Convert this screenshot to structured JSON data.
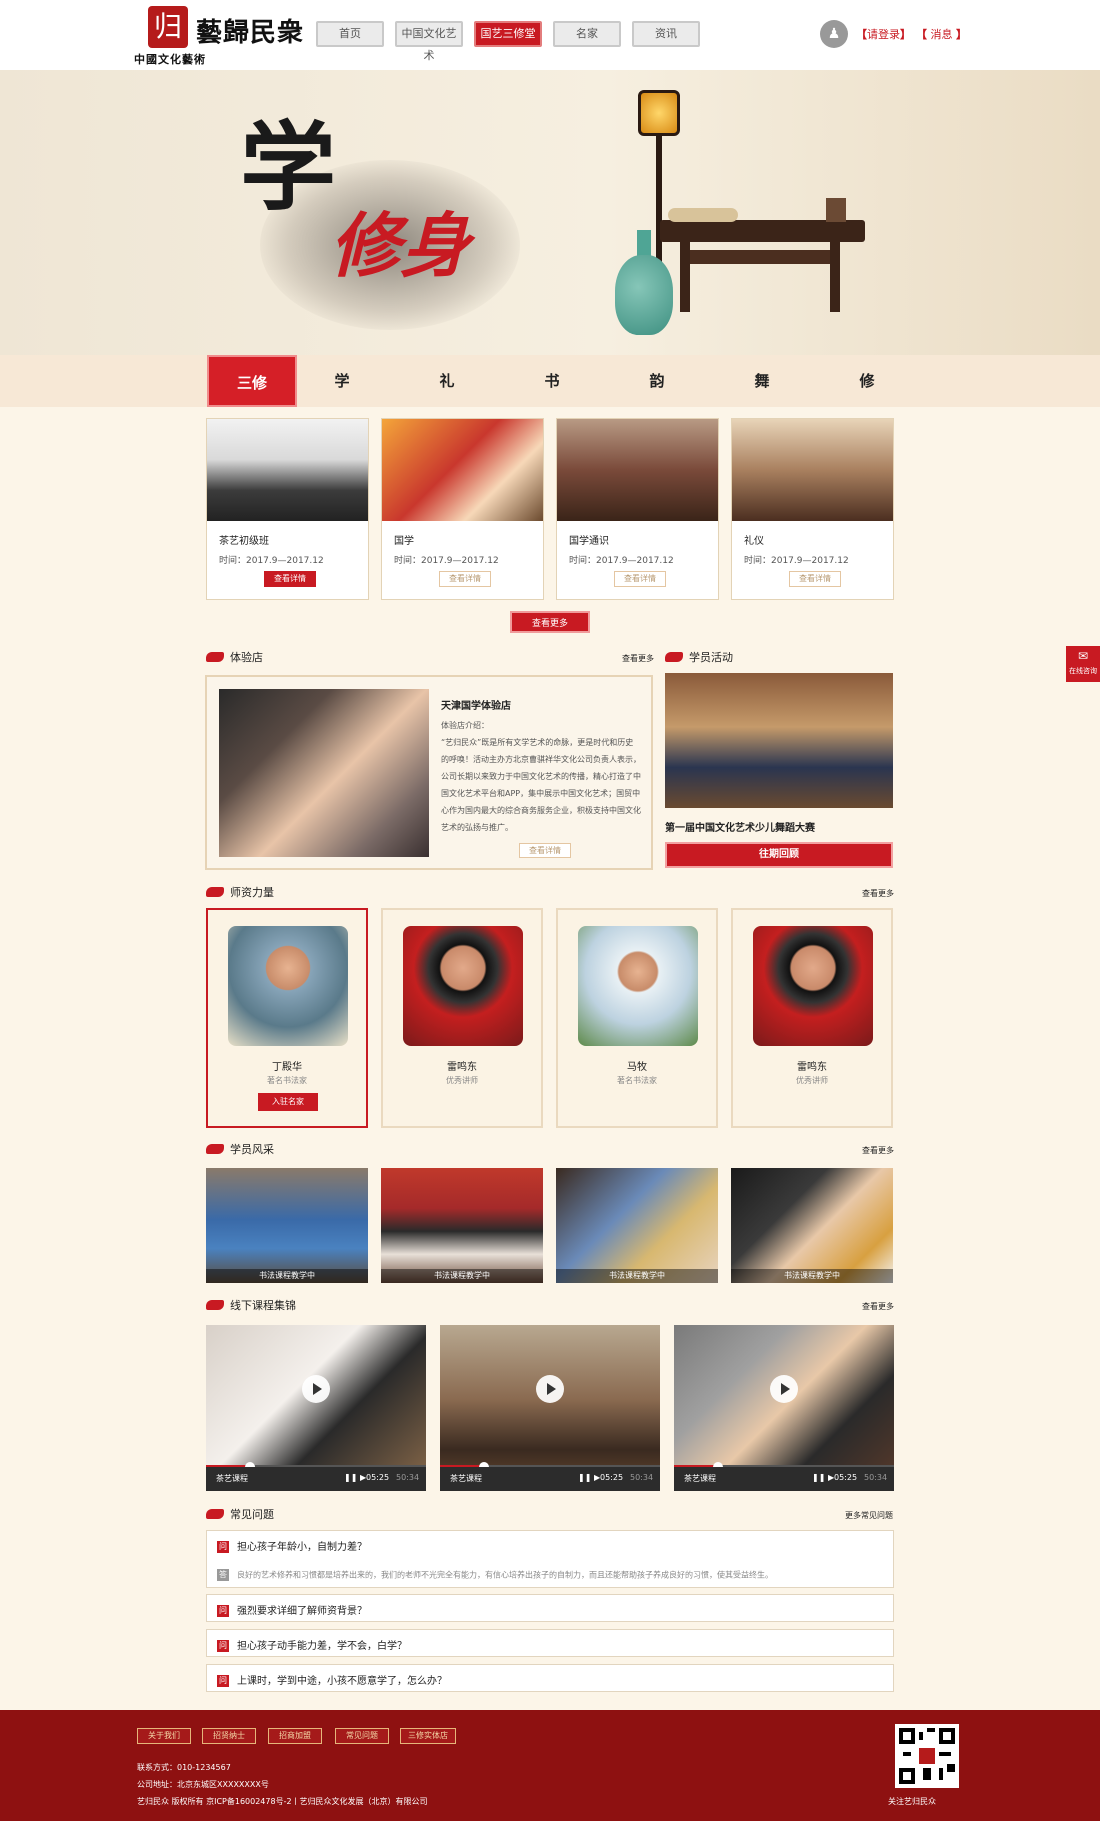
{
  "header": {
    "logo_text": "藝歸民衆",
    "logo_mark": "归",
    "logo_sub": "中國文化藝術",
    "nav": [
      "首页",
      "中国文化艺术",
      "国艺三修堂",
      "名家",
      "资讯"
    ],
    "nav_active": 2,
    "login": "请登录",
    "message": "消息"
  },
  "banner": {
    "char1": "学",
    "char2": "修身"
  },
  "tabs": [
    "三修",
    "学",
    "礼",
    "书",
    "韵",
    "舞",
    "修"
  ],
  "courses": [
    {
      "title": "茶艺初级班",
      "date": "时间：2017.9—2017.12",
      "btn": "查看详情",
      "active": true
    },
    {
      "title": "国学",
      "date": "时间：2017.9—2017.12",
      "btn": "查看详情",
      "active": false
    },
    {
      "title": "国学通识",
      "date": "时间：2017.9—2017.12",
      "btn": "查看详情",
      "active": false
    },
    {
      "title": "礼仪",
      "date": "时间：2017.9—2017.12",
      "btn": "查看详情",
      "active": false
    }
  ],
  "more_btn": "查看更多",
  "experience": {
    "section": "体验店",
    "more": "查看更多",
    "title": "天津国学体验店",
    "label": "体验店介绍：",
    "desc": "“艺归民众”既是所有文学艺术的命脉，更是时代和历史的呼唤！活动主办方北京曹骐祥华文化公司负责人表示，公司长期以来致力于中国文化艺术的传播，精心打造了中国文化艺术平台和APP，集中展示中国文化艺术；国贸中心作为国内最大的综合商务服务企业，积极支持中国文化艺术的弘扬与推广。",
    "btn": "查看详情"
  },
  "activity": {
    "section": "学员活动",
    "title": "第一届中国文化艺术少儿舞蹈大赛",
    "btn": "往期回顾"
  },
  "teachers": {
    "section": "师资力量",
    "more": "查看更多",
    "items": [
      {
        "name": "丁殿华",
        "role": "著名书法家",
        "btn": "入驻名家"
      },
      {
        "name": "雷鸣东",
        "role": "优秀讲师"
      },
      {
        "name": "马牧",
        "role": "著名书法家"
      },
      {
        "name": "雷鸣东",
        "role": "优秀讲师"
      }
    ]
  },
  "students": {
    "section": "学员风采",
    "more": "查看更多",
    "captions": [
      "书法课程教学中",
      "书法课程教学中",
      "书法课程教学中",
      "书法课程教学中"
    ]
  },
  "videos": {
    "section": "线下课程集锦",
    "more": "查看更多",
    "items": [
      {
        "label": "茶艺课程",
        "time": "05:25",
        "duration": "50:34",
        "progress": 0.2
      },
      {
        "label": "茶艺课程",
        "time": "05:25",
        "duration": "50:34",
        "progress": 0.2
      },
      {
        "label": "茶艺课程",
        "time": "05:25",
        "duration": "50:34",
        "progress": 0.2
      }
    ]
  },
  "faq": {
    "section": "常见问题",
    "more": "更多常见问题",
    "items": [
      {
        "q": "担心孩子年龄小，自制力差？",
        "a": "良好的艺术修养和习惯都是培养出来的，我们的老师不光完全有能力，有信心培养出孩子的自制力，而且还能帮助孩子养成良好的习惯，使其受益终生。"
      },
      {
        "q": "强烈要求详细了解师资背景？"
      },
      {
        "q": "担心孩子动手能力差，学不会，白学？"
      },
      {
        "q": "上课时，学到中途，小孩不愿意学了，怎么办？"
      }
    ]
  },
  "footer": {
    "links": [
      "关于我们",
      "招贤纳士",
      "招商加盟",
      "常见问题",
      "三修实体店"
    ],
    "contact": "联系方式：010-1234567",
    "address": "公司地址：北京东城区XXXXXXXX号",
    "copyright": "艺归民众 版权所有   京ICP备16002478号-2丨艺归民众文化发展（北京）有限公司",
    "qr_caption": "关注艺归民众"
  },
  "side": {
    "label": "在线咨询"
  },
  "colors": {
    "accent": "#c81a22",
    "bg": "#fcf5e8",
    "footer": "#8e1111"
  }
}
